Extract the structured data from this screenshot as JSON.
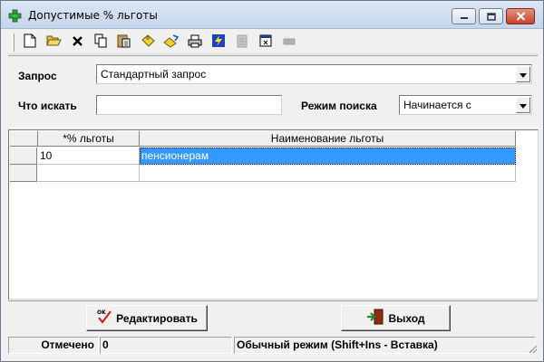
{
  "window": {
    "title": "Допустимые % льготы",
    "icon": "green-cross-icon",
    "controls": [
      "minimize-icon",
      "maximize-icon",
      "close-icon"
    ]
  },
  "toolbar": {
    "buttons": [
      {
        "name": "new-doc-icon",
        "enabled": true
      },
      {
        "name": "open-folder-icon",
        "enabled": true
      },
      {
        "name": "delete-x-icon",
        "enabled": true
      },
      {
        "name": "copy-icon",
        "enabled": true
      },
      {
        "name": "paste-icon",
        "enabled": true
      },
      {
        "name": "tag-icon",
        "enabled": true
      },
      {
        "name": "edit-tag-icon",
        "enabled": true
      },
      {
        "name": "print-icon",
        "enabled": true
      },
      {
        "name": "lightning-icon",
        "enabled": true
      },
      {
        "name": "disabled-doc-icon",
        "enabled": false
      },
      {
        "name": "dialog-icon",
        "enabled": true
      },
      {
        "name": "disabled-bar-icon",
        "enabled": false
      }
    ]
  },
  "form": {
    "query_label": "Запрос",
    "query_value": "Стандартный запрос",
    "search_label": "Что искать",
    "search_value": "",
    "mode_label": "Режим поиска",
    "mode_value": "Начинается с"
  },
  "grid": {
    "columns": [
      "*% льготы",
      "Наименование льготы"
    ],
    "rows": [
      [
        "10",
        "пенсионерам"
      ],
      [
        "",
        ""
      ]
    ]
  },
  "buttons": {
    "edit_label": "Редактировать",
    "exit_label": "Выход"
  },
  "status": {
    "marked_label": "Отмечено",
    "marked_value": "0",
    "mode_text": "Обычный режим (Shift+Ins - Вставка)"
  },
  "colors": {
    "selection": "#3399ff",
    "title_bg": "#c5d5ea",
    "close_red": "#c4442a"
  }
}
